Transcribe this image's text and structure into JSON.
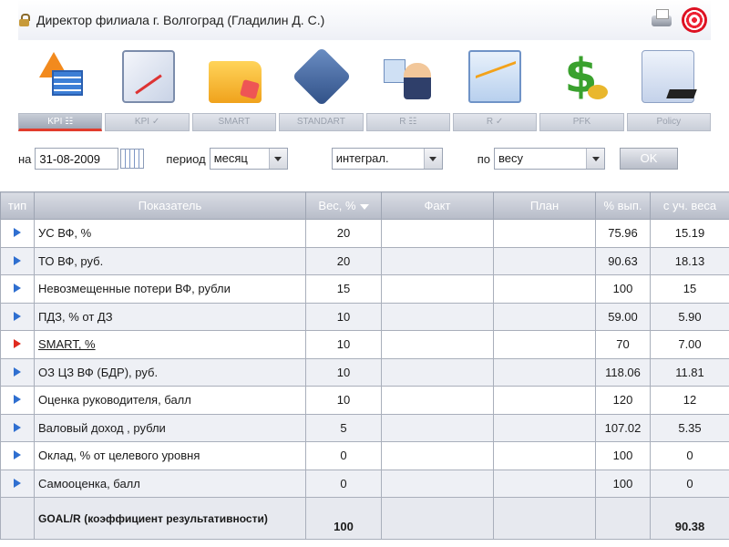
{
  "header": {
    "title": "Директор филиала г. Волгоград  (Гладилин Д. С.)"
  },
  "nav": {
    "icons": [
      "kpi-table-icon",
      "clipboard-chart-icon",
      "folder-icon",
      "goal-icon",
      "people-icon",
      "chart-icon",
      "dollar-icon",
      "policy-icon"
    ],
    "tabs": [
      "KPI ☷",
      "KPI ✓",
      "SMART",
      "STANDART",
      "R ☷",
      "R ✓",
      "PFK",
      "Policy"
    ],
    "active_tab": "KPI ☷"
  },
  "filter": {
    "on_label": "на",
    "date": "31-08-2009",
    "period_label": "период",
    "period": "месяц",
    "mode": "интеграл.",
    "by_label": "по",
    "by": "весу",
    "ok": "OK"
  },
  "table": {
    "headers": {
      "type": "тип",
      "indicator": "Показатель",
      "weight": "Вес, %",
      "fact": "Факт",
      "plan": "План",
      "pct": "% вып.",
      "weighted": "с уч. веса"
    },
    "rows": [
      {
        "type": "blue",
        "name": "УС ВФ, %",
        "weight": "20",
        "fact": "",
        "plan": "",
        "pct": "75.96",
        "weighted": "15.19"
      },
      {
        "type": "blue",
        "name": "ТО ВФ, руб.",
        "weight": "20",
        "fact": "",
        "plan": "",
        "pct": "90.63",
        "weighted": "18.13"
      },
      {
        "type": "blue",
        "name": "Невозмещенные потери ВФ, рубли",
        "weight": "15",
        "fact": "",
        "plan": "",
        "pct": "100",
        "weighted": "15"
      },
      {
        "type": "blue",
        "name": "ПДЗ, % от ДЗ",
        "weight": "10",
        "fact": "",
        "plan": "",
        "pct": "59.00",
        "weighted": "5.90"
      },
      {
        "type": "red",
        "name": "SMART, %",
        "weight": "10",
        "fact": "",
        "plan": "",
        "pct": "70",
        "weighted": "7.00"
      },
      {
        "type": "blue",
        "name": "ОЗ ЦЗ ВФ (БДР), руб.",
        "weight": "10",
        "fact": "",
        "plan": "",
        "pct": "118.06",
        "weighted": "11.81"
      },
      {
        "type": "blue",
        "name": "Оценка руководителя, балл",
        "weight": "10",
        "fact": "",
        "plan": "",
        "pct": "120",
        "weighted": "12"
      },
      {
        "type": "blue",
        "name": "Валовый доход , рубли",
        "weight": "5",
        "fact": "",
        "plan": "",
        "pct": "107.02",
        "weighted": "5.35"
      },
      {
        "type": "blue",
        "name": "Оклад, % от целевого уровня",
        "weight": "0",
        "fact": "",
        "plan": "",
        "pct": "100",
        "weighted": "0"
      },
      {
        "type": "blue",
        "name": "Самооценка, балл",
        "weight": "0",
        "fact": "",
        "plan": "",
        "pct": "100",
        "weighted": "0"
      }
    ],
    "total": {
      "name": "GOAL/R",
      "subtitle": "(коэффициент результативности)",
      "weight": "100",
      "weighted": "90.38"
    }
  },
  "colors": {
    "row_arrow": "#2f6fd0",
    "row_arrow_alert": "#e02a1e",
    "active_tab_underline": "#e23c2c"
  }
}
